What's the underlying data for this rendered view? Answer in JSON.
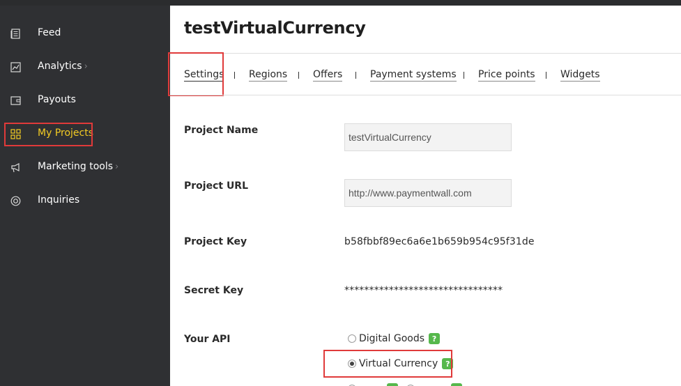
{
  "sidebar": {
    "items": [
      {
        "label": "Feed",
        "icon": "feed-icon",
        "has_submenu": false
      },
      {
        "label": "Analytics",
        "icon": "analytics-icon",
        "has_submenu": true
      },
      {
        "label": "Payouts",
        "icon": "wallet-icon",
        "has_submenu": false
      },
      {
        "label": "My Projects",
        "icon": "grid-icon",
        "has_submenu": false,
        "active": true
      },
      {
        "label": "Marketing tools",
        "icon": "megaphone-icon",
        "has_submenu": true
      },
      {
        "label": "Inquiries",
        "icon": "lifebuoy-icon",
        "has_submenu": false
      }
    ],
    "chevron": "›"
  },
  "main": {
    "title": "testVirtualCurrency",
    "tabs": [
      "Settings",
      "Regions",
      "Offers",
      "Payment systems",
      "Price points",
      "Widgets"
    ],
    "selected_tab": "Settings"
  },
  "form": {
    "project_name": {
      "label": "Project Name",
      "value": "testVirtualCurrency"
    },
    "project_url": {
      "label": "Project URL",
      "value": "http://www.paymentwall.com"
    },
    "project_key": {
      "label": "Project Key",
      "value": "b58fbbf89ec6a6e1b659b954c95f31de"
    },
    "secret_key": {
      "label": "Secret Key",
      "value": "********************************"
    },
    "api": {
      "label": "Your API",
      "options": [
        {
          "label": "Digital Goods",
          "selected": false
        },
        {
          "label": "Virtual Currency",
          "selected": true
        }
      ],
      "help_label": "?"
    }
  },
  "colors": {
    "sidebar_bg": "#2f3033",
    "active_nav": "#f3cb23",
    "highlight": "#e03a3a",
    "help_badge": "#56b84c"
  }
}
